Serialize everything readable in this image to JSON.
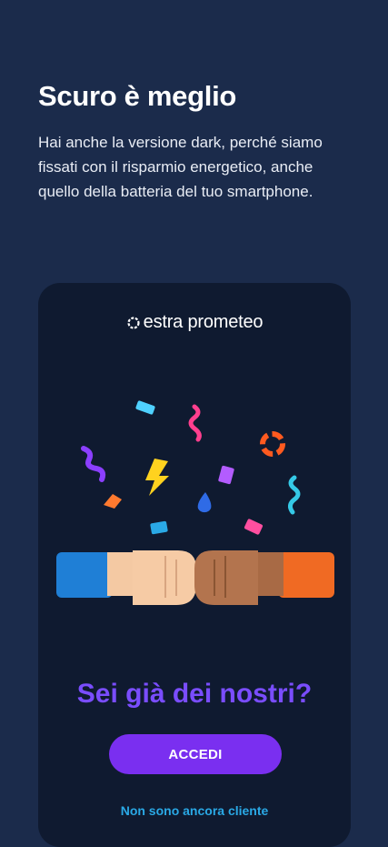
{
  "screen": {
    "title": "Scuro è meglio",
    "description": "Hai anche la versione dark, perché siamo fissati con il risparmio energetico, anche quello della batteria del tuo smartphone."
  },
  "app": {
    "logo_text": "estra prometeo",
    "question": "Sei già dei nostri?",
    "login_button": "ACCEDI",
    "not_customer_link": "Non sono ancora cliente",
    "illustration": "fist-bump-confetti",
    "colors": {
      "background": "#1b2b4b",
      "card": "#0f1a30",
      "accent_purple": "#7a2ff0",
      "link_blue": "#2aa9e6"
    }
  }
}
